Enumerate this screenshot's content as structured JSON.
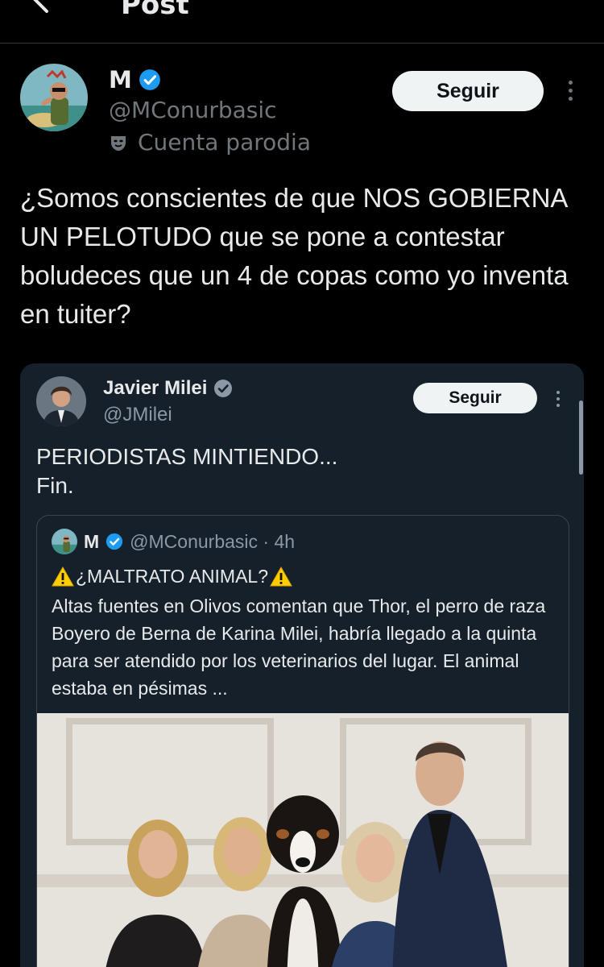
{
  "topbar": {
    "title": "Post",
    "back_icon": "arrow-left-icon"
  },
  "author": {
    "name": "M",
    "handle": "@MConurbasic",
    "badge": "Cuenta parodia",
    "verified_color": "#1d9bf0"
  },
  "follow_label": "Seguir",
  "tweet_text": "¿Somos conscientes de que NOS GOBIERNA UN PELOTUDO que se pone a contestar boludeces que un 4 de copas como yo inventa en tuiter?",
  "quoted": {
    "name": "Javier Milei",
    "handle": "@JMilei",
    "follow_label": "Seguir",
    "text_line1": "PERIODISTAS MINTIENDO...",
    "text_line2": "Fin.",
    "inner": {
      "name": "M",
      "handle_time": "@MConurbasic · 4h",
      "title": "¿MALTRATO ANIMAL?",
      "body": "Altas fuentes en Olivos comentan que Thor, el perro de raza Boyero de Berna de Karina Milei, habría llegado a la quinta para ser atendido por los veterinarios del lugar. El animal estaba en pésimas ..."
    }
  },
  "colors": {
    "background": "#000000",
    "card": "#15202b",
    "accent": "#1d9bf0",
    "muted": "#71767b",
    "warning": "#ffcc00"
  }
}
